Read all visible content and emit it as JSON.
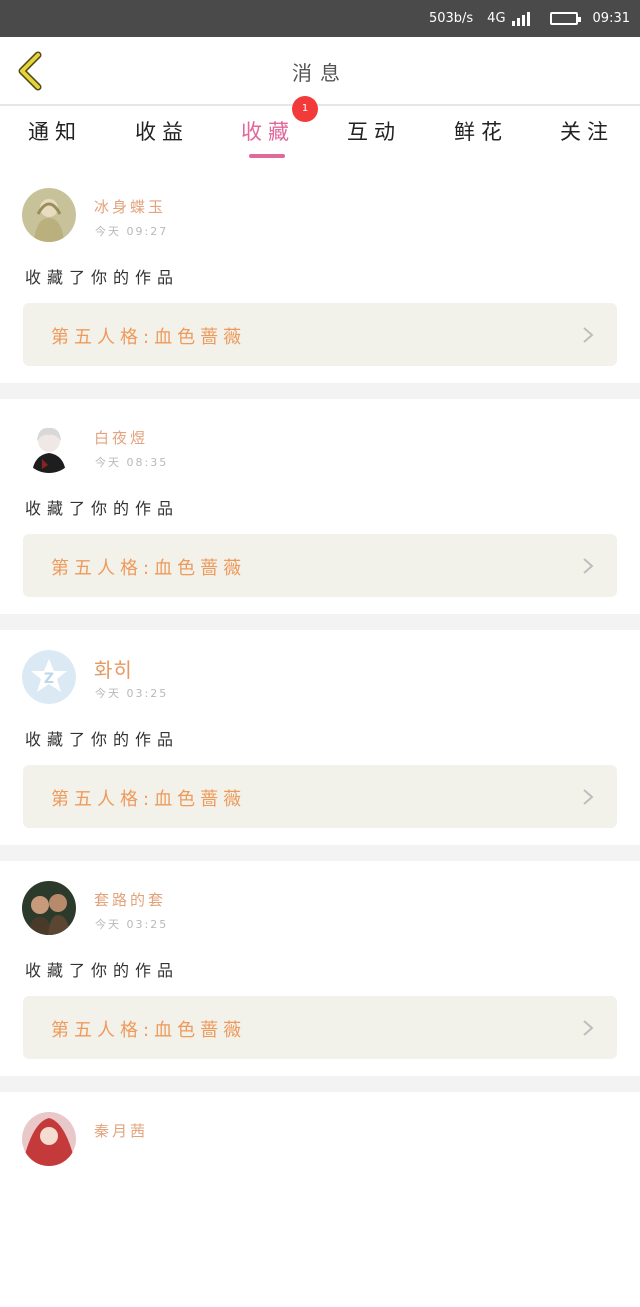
{
  "status_bar": {
    "net_speed": "503b/s",
    "network": "4G",
    "time": "09:31"
  },
  "header": {
    "title": "消息",
    "back_icon": "chevron-left-icon"
  },
  "tabs": [
    {
      "label": "通知"
    },
    {
      "label": "收益"
    },
    {
      "label": "收藏",
      "active": true,
      "badge": "1"
    },
    {
      "label": "互动"
    },
    {
      "label": "鲜花"
    },
    {
      "label": "关注"
    }
  ],
  "messages": [
    {
      "user": "冰身蝶玉",
      "time": "今天 09:27",
      "action": "收藏了你的作品",
      "work": "第五人格:血色蔷薇"
    },
    {
      "user": "白夜煜",
      "time": "今天 08:35",
      "action": "收藏了你的作品",
      "work": "第五人格:血色蔷薇"
    },
    {
      "user": "화히",
      "time": "今天 03:25",
      "action": "收藏了你的作品",
      "work": "第五人格:血色蔷薇"
    },
    {
      "user": "套路的套",
      "time": "今天 03:25",
      "action": "收藏了你的作品",
      "work": "第五人格:血色蔷薇"
    },
    {
      "user": "秦月茜"
    }
  ],
  "colors": {
    "accent": "#e0689b",
    "badge": "#f23a3a",
    "username": "#e3a37c",
    "work_title": "#ee9a5c",
    "work_bg": "#f2f2ea",
    "status_bar": "#4a4a4a",
    "back_arrow": "#e8d23a"
  }
}
